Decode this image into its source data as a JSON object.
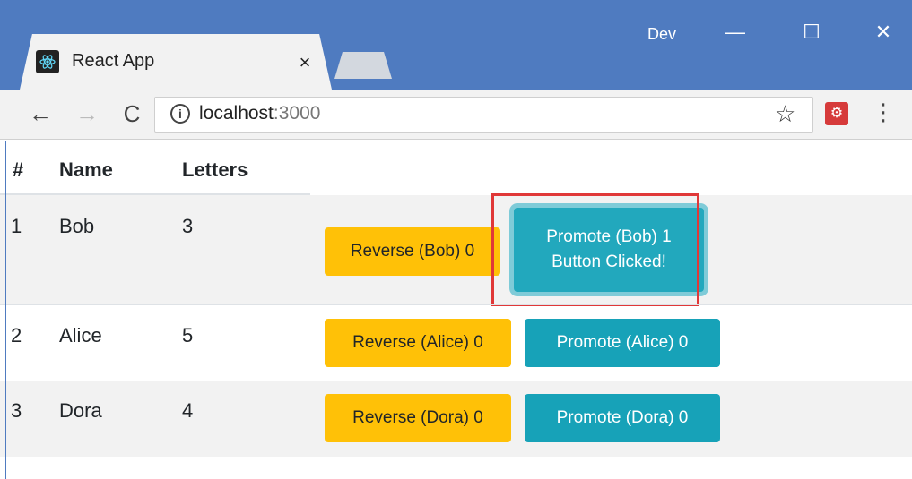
{
  "browser": {
    "tab_title": "React App",
    "tab_close": "×",
    "profile_label": "Dev",
    "window_controls": {
      "minimize": "—",
      "maximize": "☐",
      "close": "✕"
    },
    "nav": {
      "back": "←",
      "forward": "→",
      "reload": "C"
    },
    "url_host": "localhost",
    "url_port": ":3000",
    "icons": [
      "react-favicon-icon",
      "info-icon",
      "star-icon",
      "extension-icon",
      "kebab-menu-icon"
    ]
  },
  "table": {
    "headers": [
      "#",
      "Name",
      "Letters"
    ],
    "rows": [
      {
        "num": "1",
        "name": "Bob",
        "letters": "3",
        "reverse_label": "Reverse (Bob) 0",
        "promote_line1": "Promote (Bob) 1",
        "promote_line2": "Button Clicked!"
      },
      {
        "num": "2",
        "name": "Alice",
        "letters": "5",
        "reverse_label": "Reverse (Alice) 0",
        "promote_label": "Promote (Alice) 0"
      },
      {
        "num": "3",
        "name": "Dora",
        "letters": "4",
        "reverse_label": "Reverse (Dora) 0",
        "promote_label": "Promote (Dora) 0"
      }
    ]
  },
  "colors": {
    "title_bar": "#4f7bc0",
    "warning": "#ffc107",
    "info": "#17a2b8",
    "highlight": "#e03838"
  }
}
